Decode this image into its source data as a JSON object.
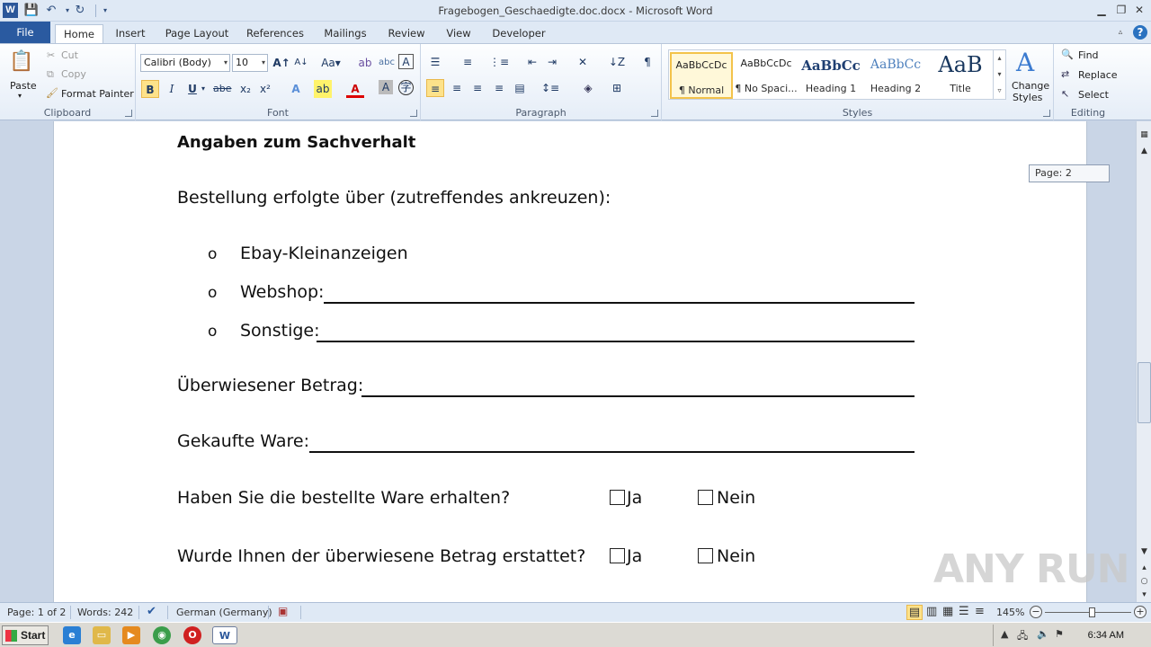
{
  "window": {
    "title": "Fragebogen_Geschaedigte.doc.docx - Microsoft Word",
    "app_icon": "W"
  },
  "tabs": [
    "File",
    "Home",
    "Insert",
    "Page Layout",
    "References",
    "Mailings",
    "Review",
    "View",
    "Developer"
  ],
  "active_tab": "Home",
  "clipboard": {
    "label": "Clipboard",
    "paste": "Paste",
    "cut": "Cut",
    "copy": "Copy",
    "format_painter": "Format Painter"
  },
  "font": {
    "label": "Font",
    "family": "Calibri (Body)",
    "size": "10"
  },
  "paragraph": {
    "label": "Paragraph"
  },
  "styles": {
    "label": "Styles",
    "items": [
      {
        "preview": "AaBbCcDc",
        "name": "¶ Normal"
      },
      {
        "preview": "AaBbCcDc",
        "name": "¶ No Spaci..."
      },
      {
        "preview": "AaBbCc",
        "name": "Heading 1"
      },
      {
        "preview": "AaBbCc",
        "name": "Heading 2"
      },
      {
        "preview": "AaB",
        "name": "Title"
      }
    ],
    "change_styles_1": "Change",
    "change_styles_2": "Styles"
  },
  "editing": {
    "label": "Editing",
    "find": "Find",
    "replace": "Replace",
    "select": "Select"
  },
  "document": {
    "heading": "Angaben zum Sachverhalt",
    "order_question": "Bestellung erfolgte über (zutreffendes ankreuzen):",
    "options": [
      "Ebay-Kleinanzeigen",
      "Webshop:",
      "Sonstige:"
    ],
    "amount_label": "Überwiesener  Betrag:",
    "goods_label": "Gekaufte Ware:",
    "q_received": "Haben Sie die bestellte Ware erhalten?",
    "q_refunded": "Wurde Ihnen der überwiesene Betrag erstattet?",
    "yes": "Ja",
    "no": "Nein"
  },
  "page_tooltip": "Page: 2",
  "watermark": "ANY RUN",
  "status": {
    "page": "Page: 1 of 2",
    "words": "Words: 242",
    "language": "German (Germany)",
    "zoom": "145%"
  },
  "taskbar": {
    "start": "Start",
    "clock": "6:34 AM"
  }
}
